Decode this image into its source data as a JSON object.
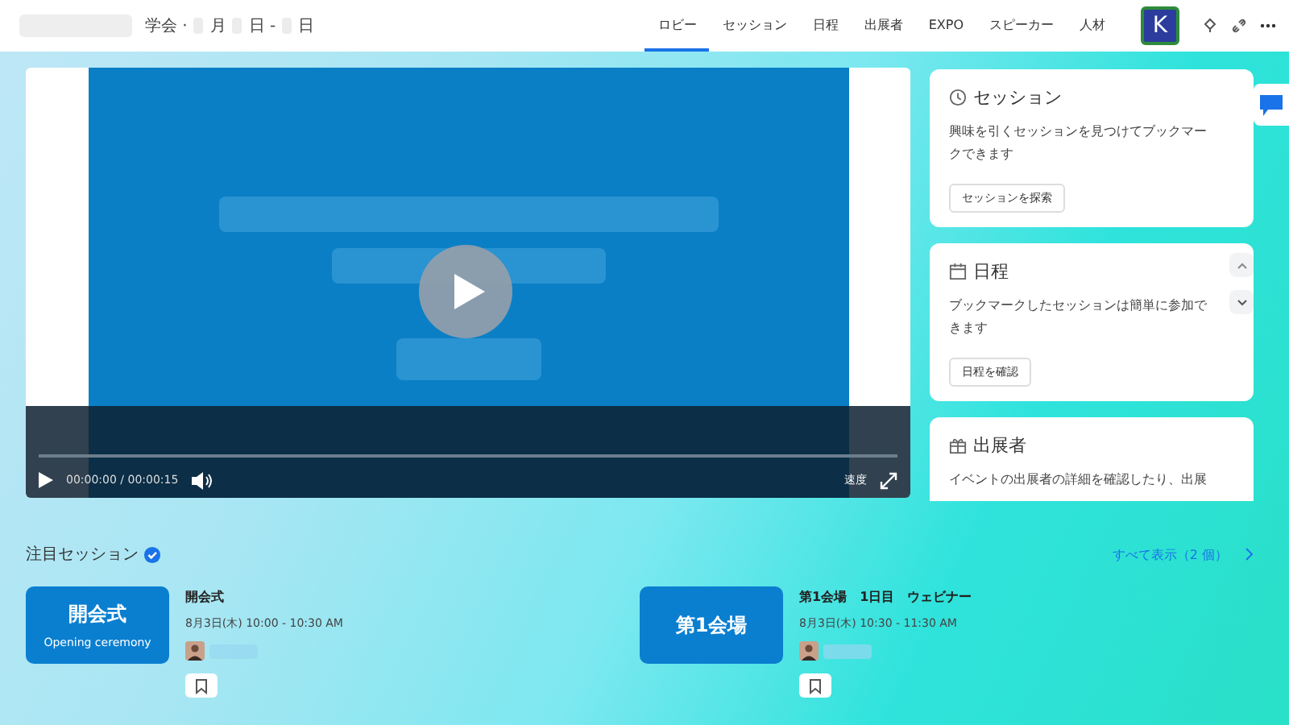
{
  "header": {
    "title": "学会 ·",
    "date_parts": [
      "月",
      "日 -",
      "日"
    ],
    "tabs": [
      {
        "label": "ロビー",
        "selected": true
      },
      {
        "label": "セッション",
        "selected": false
      },
      {
        "label": "日程",
        "selected": false
      },
      {
        "label": "出展者",
        "selected": false
      },
      {
        "label": "EXPO",
        "selected": false
      },
      {
        "label": "スピーカー",
        "selected": false
      },
      {
        "label": "人材",
        "selected": false
      }
    ],
    "avatar": "K"
  },
  "video": {
    "time": "00:00:00 / 00:00:15",
    "speed": "速度"
  },
  "cards": [
    {
      "kind": "clock",
      "title": "セッション",
      "text": "興味を引くセッションを見つけてブックマークできます",
      "button": "セッションを探索"
    },
    {
      "kind": "calendar",
      "title": "日程",
      "text": "ブックマークしたセッションは簡単に参加できます",
      "button": "日程を確認"
    },
    {
      "kind": "gift",
      "title": "出展者",
      "text": "イベントの出展者の詳細を確認したり、出展"
    }
  ],
  "featured": {
    "title": "注目セッション",
    "show_all": "すべて表示（2 個）",
    "sessions": [
      {
        "thumb_title": "開会式",
        "thumb_subtitle": "Opening ceremony",
        "title": "開会式",
        "time": "8月3日(木) 10:00 - 10:30 AM"
      },
      {
        "thumb_title": "第1会場",
        "title": "第1会場　1日目　ウェビナー",
        "time": "8月3日(木) 10:30 - 11:30 AM"
      }
    ]
  }
}
